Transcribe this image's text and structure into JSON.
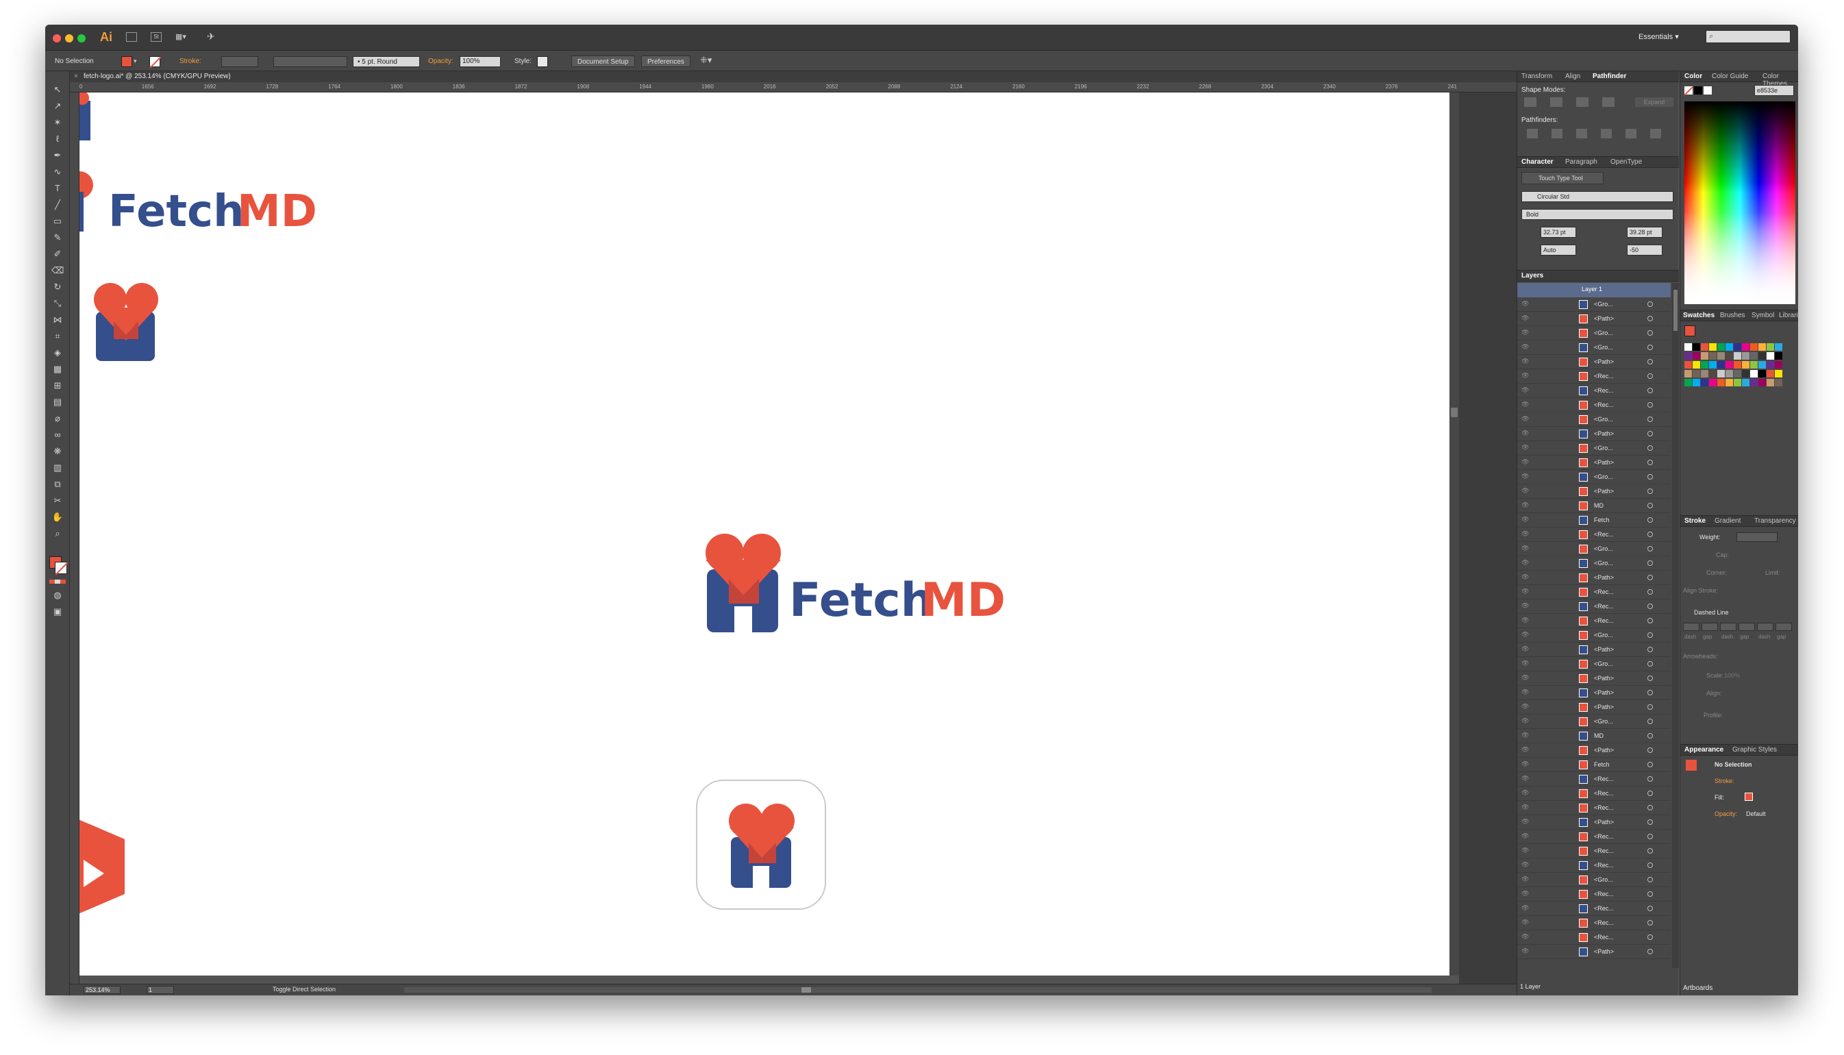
{
  "app": {
    "logo": "Ai",
    "workspace": "Essentials",
    "search_placeholder": ""
  },
  "control_bar": {
    "selection": "No Selection",
    "stroke_label": "Stroke:",
    "brush_label": "5 pt. Round",
    "opacity_label": "Opacity:",
    "opacity_value": "100%",
    "style_label": "Style:",
    "document_setup": "Document Setup",
    "preferences": "Preferences"
  },
  "document": {
    "tab_title": "fetch-logo.ai* @ 253.14% (CMYK/GPU Preview)",
    "ruler_ticks": [
      "0",
      "1656",
      "1692",
      "1728",
      "1764",
      "1800",
      "1836",
      "1872",
      "1908",
      "1944",
      "1980",
      "2016",
      "2052",
      "2088",
      "2124",
      "2160",
      "2196",
      "2232",
      "2268",
      "2304",
      "2340",
      "2376",
      "241"
    ]
  },
  "canvas": {
    "logo_fetch": "Fetch",
    "logo_md": "MD",
    "colors": {
      "red": "#e8533e",
      "blue": "#354e8c"
    }
  },
  "status_bar": {
    "zoom": "253.14%",
    "artboard": "1",
    "tool": "Toggle Direct Selection"
  },
  "pathfinder_panel": {
    "tabs": [
      "Transform",
      "Align",
      "Pathfinder"
    ],
    "active_tab": "Pathfinder",
    "shape_modes_label": "Shape Modes:",
    "expand_label": "Expand",
    "pathfinders_label": "Pathfinders:"
  },
  "character_panel": {
    "tabs": [
      "Character",
      "Paragraph",
      "OpenType"
    ],
    "active_tab": "Character",
    "touch_type": "Touch Type Tool",
    "font_family": "Circular Std",
    "font_style": "Bold",
    "font_size": "32.73 pt",
    "leading": "39.28 pt",
    "kerning": "Auto",
    "tracking": "-50"
  },
  "layers_panel": {
    "title": "Layers",
    "layer_name": "Layer 1",
    "rows": [
      "<Gro...",
      "<Path>",
      "<Gro...",
      "<Gro...",
      "<Path>",
      "<Rec...",
      "<Rec...",
      "<Rec...",
      "<Gro...",
      "<Path>",
      "<Gro...",
      "<Path>",
      "<Gro...",
      "<Path>",
      "MD",
      "Fetch",
      "<Rec...",
      "<Gro...",
      "<Gro...",
      "<Path>",
      "<Rec...",
      "<Rec...",
      "<Rec...",
      "<Gro...",
      "<Path>",
      "<Gro...",
      "<Path>",
      "<Path>",
      "<Path>",
      "<Gro...",
      "MD",
      "<Path>",
      "Fetch",
      "<Rec...",
      "<Rec...",
      "<Rec...",
      "<Path>",
      "<Rec...",
      "<Rec...",
      "<Rec...",
      "<Gro...",
      "<Rec...",
      "<Rec...",
      "<Rec...",
      "<Rec...",
      "<Path>"
    ],
    "footer": "1 Layer"
  },
  "color_panel": {
    "tabs": [
      "Color",
      "Color Guide",
      "Color Themes"
    ],
    "active_tab": "Color",
    "hex_value": "e8533e"
  },
  "swatches_panel": {
    "tabs": [
      "Swatches",
      "Brushes",
      "Symbol",
      "Librarie"
    ]
  },
  "stroke_panel": {
    "tabs": [
      "Stroke",
      "Gradient",
      "Transparency"
    ],
    "weight_label": "Weight:",
    "cap_label": "Cap:",
    "corner_label": "Corner:",
    "limit_label": "Limit:",
    "align_label": "Align Stroke:",
    "dashed_label": "Dashed Line",
    "dash_labels": [
      "dash",
      "gap",
      "dash",
      "gap",
      "dash",
      "gap"
    ],
    "arrowheads_label": "Arrowheads:",
    "scale_label": "Scale:",
    "scale_value": "100%",
    "align_label2": "Align:",
    "profile_label": "Profile:"
  },
  "appearance_panel": {
    "tabs": [
      "Appearance",
      "Graphic Styles"
    ],
    "title": "No Selection",
    "stroke_label": "Stroke:",
    "fill_label": "Fill:",
    "opacity_label": "Opacity:",
    "opacity_value": "Default"
  },
  "artboards_label": "Artboards"
}
